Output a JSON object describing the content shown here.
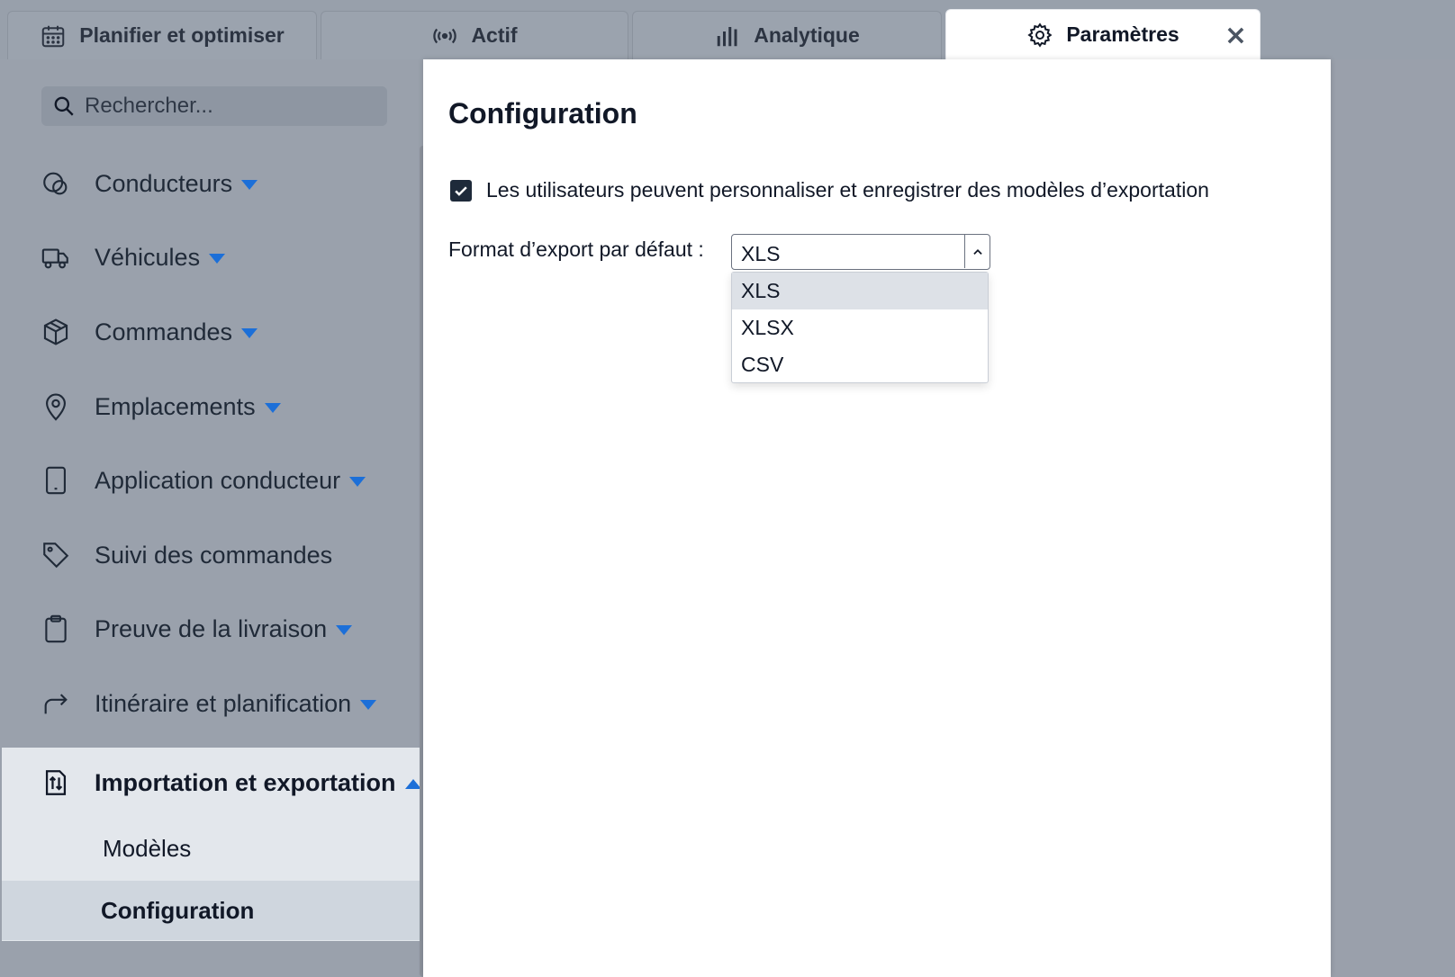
{
  "tabs": [
    {
      "label": "Planifier et optimiser",
      "icon": "calendar-icon"
    },
    {
      "label": "Actif",
      "icon": "broadcast-icon"
    },
    {
      "label": "Analytique",
      "icon": "bar-chart-icon"
    },
    {
      "label": "Paramètres",
      "icon": "gear-icon",
      "active": true
    }
  ],
  "tab_close": "×",
  "sidebar": {
    "search_placeholder": "Rechercher...",
    "items": [
      {
        "label": "Conducteurs",
        "icon": "driver-icon",
        "expandable": true
      },
      {
        "label": "Véhicules",
        "icon": "truck-icon",
        "expandable": true
      },
      {
        "label": "Commandes",
        "icon": "package-icon",
        "expandable": true
      },
      {
        "label": "Emplacements",
        "icon": "location-pin-icon",
        "expandable": true
      },
      {
        "label": "Application conducteur",
        "icon": "phone-icon",
        "expandable": true
      },
      {
        "label": "Suivi des commandes",
        "icon": "tag-icon",
        "expandable": false
      },
      {
        "label": "Preuve de la livraison",
        "icon": "clipboard-icon",
        "expandable": true
      },
      {
        "label": "Itinéraire et planification",
        "icon": "route-arrow-icon",
        "expandable": true
      }
    ],
    "open_group": {
      "label": "Importation et exportation",
      "icon": "import-export-icon",
      "children": [
        {
          "label": "Modèles",
          "selected": false
        },
        {
          "label": "Configuration",
          "selected": true
        }
      ]
    }
  },
  "main": {
    "title": "Configuration",
    "checkbox_label": "Les utilisateurs peuvent personnaliser et enregistrer des modèles d’exportation",
    "checkbox_checked": true,
    "format_label": "Format d’export par défaut :",
    "format_value": "XLS",
    "format_options": [
      "XLS",
      "XLSX",
      "CSV"
    ]
  },
  "colors": {
    "accent": "#1c6fd8",
    "overlay": "#9aa1ac",
    "panel": "#ffffff"
  }
}
